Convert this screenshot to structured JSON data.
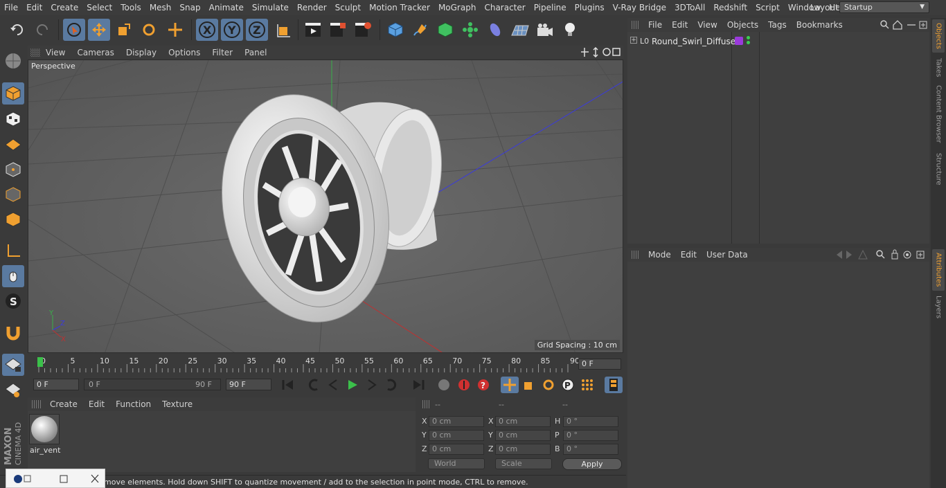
{
  "menu": [
    "File",
    "Edit",
    "Create",
    "Select",
    "Tools",
    "Mesh",
    "Snap",
    "Animate",
    "Simulate",
    "Render",
    "Sculpt",
    "Motion Tracker",
    "MoGraph",
    "Character",
    "Pipeline",
    "Plugins",
    "V-Ray Bridge",
    "3DToAll",
    "Redshift",
    "Script",
    "Window",
    "Help"
  ],
  "layout": {
    "label": "Layout:",
    "value": "Startup"
  },
  "viewport": {
    "menu": [
      "View",
      "Cameras",
      "Display",
      "Options",
      "Filter",
      "Panel"
    ],
    "camera_label": "Perspective",
    "grid_spacing": "Grid Spacing : 10 cm"
  },
  "timeline": {
    "ticks": [
      "0",
      "5",
      "10",
      "15",
      "20",
      "25",
      "30",
      "35",
      "40",
      "45",
      "50",
      "55",
      "60",
      "65",
      "70",
      "75",
      "80",
      "85",
      "90"
    ],
    "current_frame": "0 F"
  },
  "playback": {
    "start": "0 F",
    "range_start": "0 F",
    "range_end": "90 F",
    "end": "90 F"
  },
  "material_manager": {
    "menu": [
      "Create",
      "Edit",
      "Function",
      "Texture"
    ],
    "materials": [
      {
        "name": "air_vent"
      }
    ]
  },
  "coordinates": {
    "headers": [
      "--",
      "--",
      "--"
    ],
    "rows": [
      {
        "a": "X",
        "av": "0 cm",
        "b": "X",
        "bv": "0 cm",
        "c": "H",
        "cv": "0 °"
      },
      {
        "a": "Y",
        "av": "0 cm",
        "b": "Y",
        "bv": "0 cm",
        "c": "P",
        "cv": "0 °"
      },
      {
        "a": "Z",
        "av": "0 cm",
        "b": "Z",
        "bv": "0 cm",
        "c": "B",
        "cv": "0 °"
      }
    ],
    "mode1": "World",
    "mode2": "Scale",
    "apply": "Apply"
  },
  "status_text": "move elements. Hold down SHIFT to quantize movement / add to the selection in point mode, CTRL to remove.",
  "object_manager": {
    "menu": [
      "File",
      "Edit",
      "View",
      "Objects",
      "Tags",
      "Bookmarks"
    ],
    "objects": [
      {
        "name": "Round_Swirl_Diffuser"
      }
    ]
  },
  "attribute_manager": {
    "menu": [
      "Mode",
      "Edit",
      "User Data"
    ]
  },
  "right_tabs": [
    {
      "label": "Objects",
      "active": true
    },
    {
      "label": "Takes",
      "active": false
    },
    {
      "label": "Content Browser",
      "active": false
    },
    {
      "label": "Structure",
      "active": false
    },
    {
      "label": "Attributes",
      "active": true
    },
    {
      "label": "Layers",
      "active": false
    }
  ],
  "branding": {
    "line1": "MAXON",
    "line2": "CINEMA 4D"
  },
  "colors": {
    "accent_blue": "#5a7aa0",
    "orange": "#f0a030",
    "axis_green": "#39b04a",
    "axis_blue": "#3a3ae0",
    "axis_red": "#c03030",
    "tag_purple": "#9a3adb"
  }
}
